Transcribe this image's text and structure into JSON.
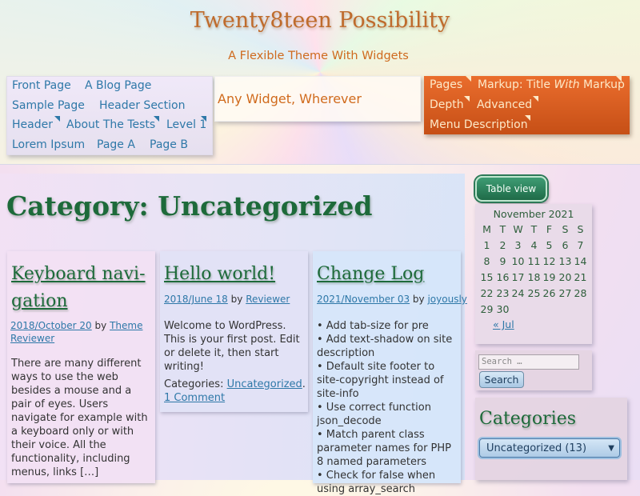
{
  "site": {
    "title": "Twenty8teen Possibility",
    "description": "A Flexible Theme With Widgets"
  },
  "primary_menu": {
    "items": [
      "Front Page",
      "A Blog Page",
      "Sample Page",
      "Header Section",
      "Header",
      "About The Tests",
      "Level 1",
      "Lorem Ipsum",
      "Page A",
      "Page B"
    ]
  },
  "header_widget": {
    "text": "Any Widget, Wherever"
  },
  "secondary_menu": {
    "pages": "Pages",
    "markup_pre": "Markup: Title ",
    "markup_em": "With",
    "markup_post": " Markup",
    "depth": "Depth",
    "advanced": "Advanced",
    "menu_description": "Menu Description"
  },
  "archive": {
    "title": "Category: Uncategorized"
  },
  "posts": [
    {
      "title_line1": "Keyboard navi-",
      "title_line2": "gation",
      "date": "2018/October 20",
      "by": "by",
      "author_line1": "Theme",
      "author_line2": "Reviewer",
      "excerpt": "There are many different ways to use the web besides a mouse and a pair of eyes. Users navigate for example with a keyboard only or with their voice. All the functionality, including menus, links […]"
    },
    {
      "title": "Hello world!",
      "date": "2018/June 18",
      "by": "by",
      "author": "Reviewer",
      "excerpt": "Welcome to WordPress. This is your first post. Edit or delete it, then start writing!",
      "categories_label": "Categories: ",
      "category": "Uncategorized",
      "sep": ".",
      "comments": "1 Comment"
    },
    {
      "title": "Change Log",
      "date": "2021/November 03",
      "by": "by",
      "author": "joyously",
      "items": [
        "• Add tab-size for pre",
        "• Add text-shadow on site description",
        "• Default site footer to site-copyright instead of site-info",
        "• Use correct function json_decode",
        "• Match parent class parameter names for PHP 8 named parameters",
        "• Check for false when using array_search"
      ]
    }
  ],
  "sidebar": {
    "table_view_button": "Table view",
    "calendar": {
      "caption": "November 2021",
      "weekdays": [
        "M",
        "T",
        "W",
        "T",
        "F",
        "S",
        "S"
      ],
      "days": [
        "1",
        "2",
        "3",
        "4",
        "5",
        "6",
        "7",
        "8",
        "9",
        "10",
        "11",
        "12",
        "13",
        "14",
        "15",
        "16",
        "17",
        "18",
        "19",
        "20",
        "21",
        "22",
        "23",
        "24",
        "25",
        "26",
        "27",
        "28",
        "29",
        "30"
      ],
      "prev_link": "« Jul"
    },
    "search": {
      "placeholder": "Search …",
      "button": "Search"
    },
    "categories": {
      "title": "Categories",
      "selected": "Uncategorized  (13)"
    }
  }
}
